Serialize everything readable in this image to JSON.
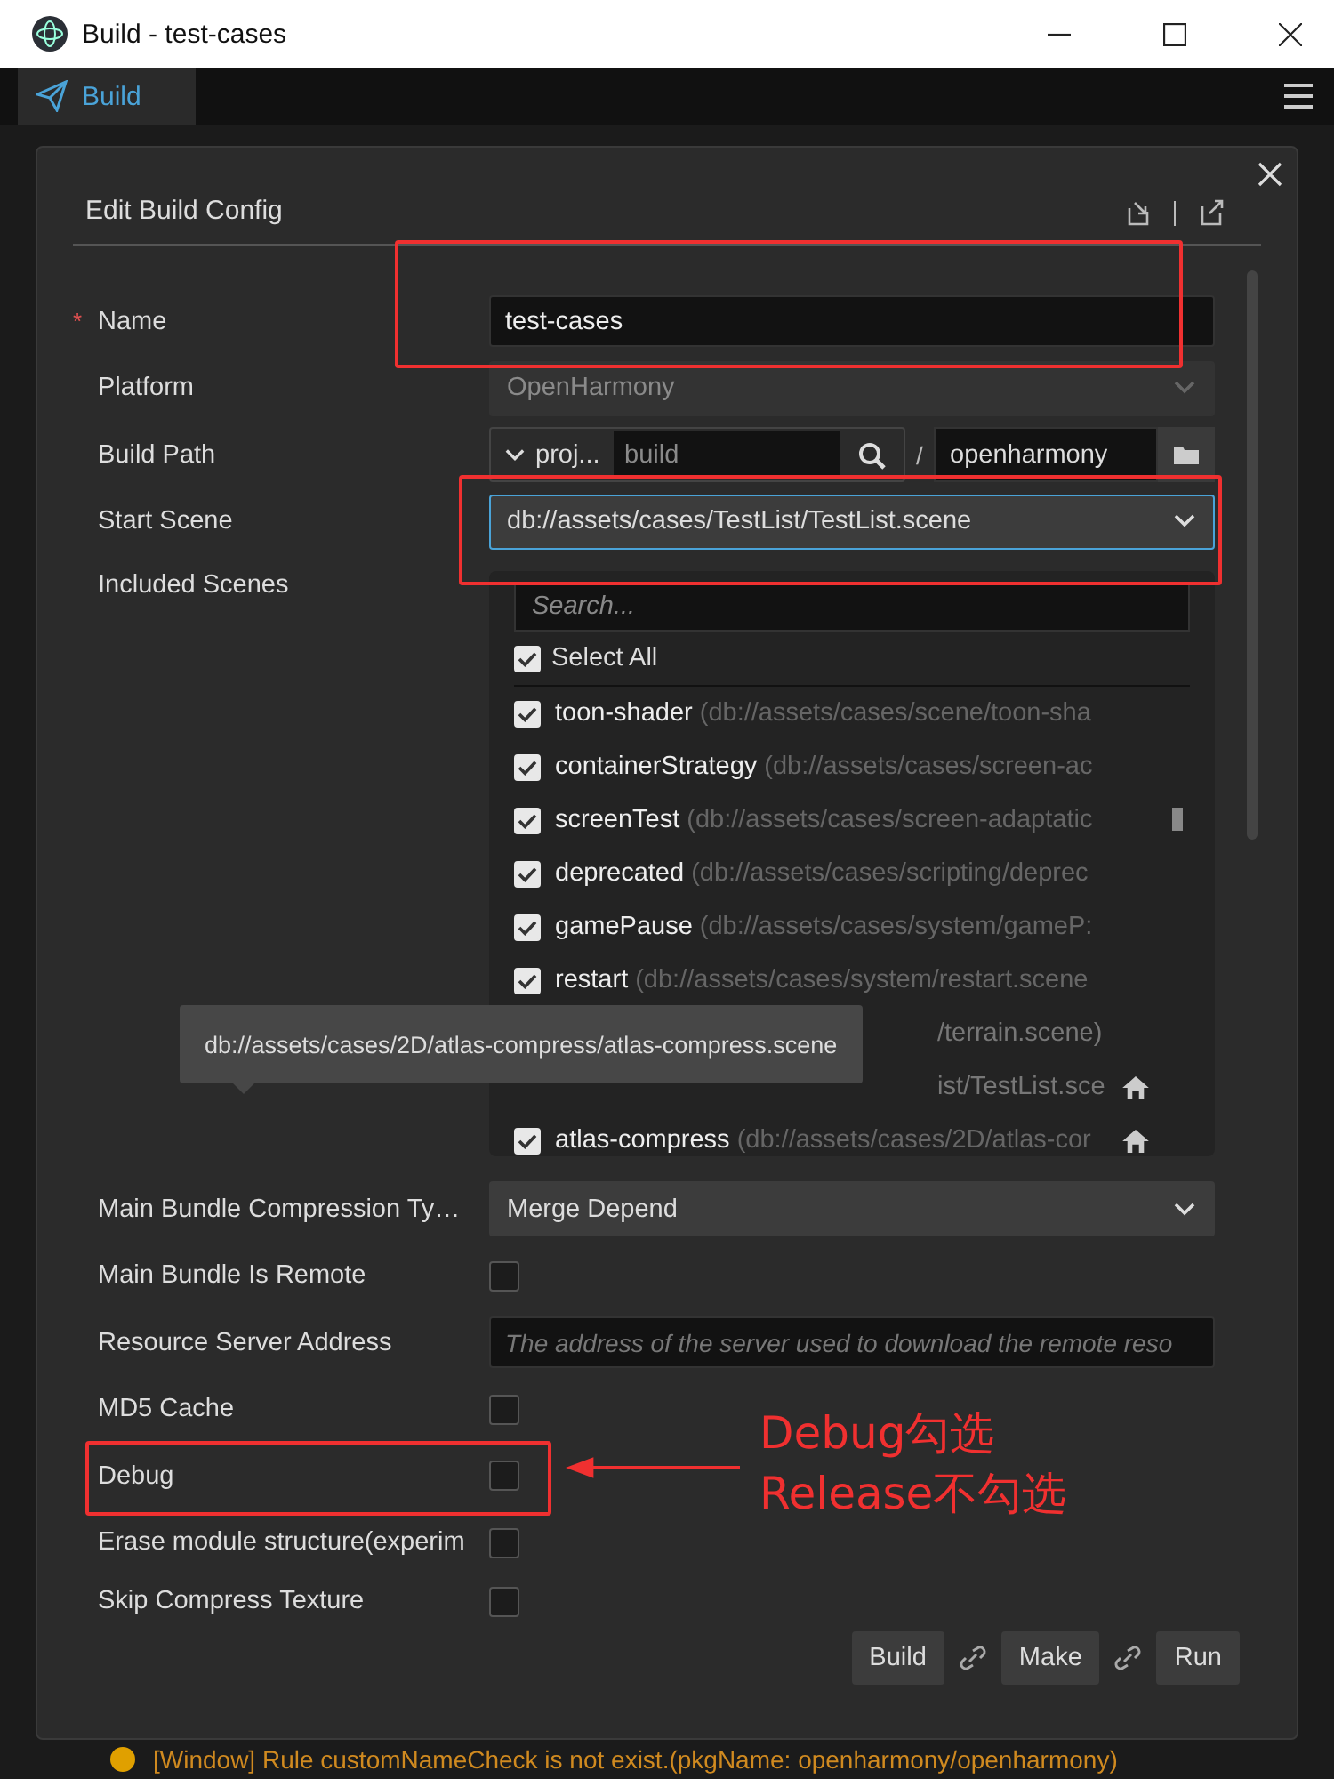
{
  "window": {
    "title": "Build - test-cases"
  },
  "tabs": [
    {
      "label": "Build",
      "selected": true
    }
  ],
  "panel": {
    "title": "Edit Build Config"
  },
  "form": [
    {
      "kind": "text",
      "label": "Name",
      "required_mark": "*",
      "value": "test-cases"
    },
    {
      "kind": "select",
      "label": "Platform",
      "value": "OpenHarmony",
      "disabled": true
    },
    {
      "kind": "path",
      "label": "Build Path",
      "prefix": "proj...",
      "placeholder": "build",
      "separator": "/",
      "value": "openharmony"
    },
    {
      "kind": "select",
      "label": "Start Scene",
      "value": "db://assets/cases/TestList/TestList.scene",
      "disabled": false,
      "focused": true
    },
    {
      "kind": "scenes",
      "label": "Included Scenes",
      "search_placeholder": "Search...",
      "select_all": {
        "label": "Select All",
        "checked": true
      },
      "items": [
        {
          "name": "toon-shader",
          "path": "(db://assets/cases/scene/toon-sha",
          "checked": true,
          "home": false
        },
        {
          "name": "containerStrategy",
          "path": "(db://assets/cases/screen-ac",
          "checked": true,
          "home": false
        },
        {
          "name": "screenTest",
          "path": "(db://assets/cases/screen-adaptatic",
          "checked": true,
          "home": false
        },
        {
          "name": "deprecated",
          "path": "(db://assets/cases/scripting/deprec",
          "checked": true,
          "home": false
        },
        {
          "name": "gamePause",
          "path": "(db://assets/cases/system/gameP:",
          "checked": true,
          "home": false
        },
        {
          "name": "restart",
          "path": "(db://assets/cases/system/restart.scene",
          "checked": true,
          "home": false
        },
        {
          "path": "/terrain.scene)",
          "home": false
        },
        {
          "path": "ist/TestList.sce",
          "home": true
        },
        {
          "name": "atlas-compress",
          "path": "(db://assets/cases/2D/atlas-cor",
          "checked": true,
          "home": true
        }
      ],
      "tooltip": "db://assets/cases/2D/atlas-compress/atlas-compress.scene"
    },
    {
      "kind": "select",
      "label": "Main Bundle Compression Ty…",
      "value": "Merge Depend",
      "disabled": false,
      "focused": false
    },
    {
      "kind": "checkbox",
      "label": "Main Bundle Is Remote",
      "checked": false
    },
    {
      "kind": "input",
      "label": "Resource Server Address",
      "placeholder": "The address of the server used to download the remote reso"
    },
    {
      "kind": "checkbox",
      "label": "MD5 Cache",
      "checked": false
    },
    {
      "kind": "checkbox",
      "label": "Debug",
      "checked": false
    },
    {
      "kind": "checkbox",
      "label": "Erase module structure(experim",
      "checked": false
    },
    {
      "kind": "checkbox",
      "label": "Skip Compress Texture",
      "checked": false
    }
  ],
  "actions": [
    "Build",
    "Make",
    "Run"
  ],
  "annotation": {
    "lines": [
      "Debug勾选",
      "Release不勾选"
    ]
  },
  "log": "[Window] Rule customNameCheck is not exist.(pkgName: openharmony/openharmony)"
}
